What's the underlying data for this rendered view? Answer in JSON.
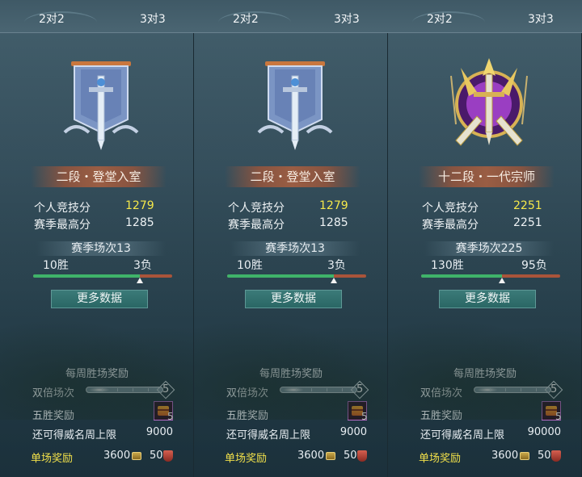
{
  "panels": [
    {
      "tabs": [
        "2对2",
        "3对3"
      ],
      "rank": "二段・登堂入室",
      "score_label": "个人竞技分",
      "score_value": "1279",
      "high_label": "赛季最高分",
      "high_value": "1285",
      "season_label": "赛季场次13",
      "wins": "10胜",
      "losses": "3负",
      "win_ratio": 0.77,
      "more_label": "更多数据",
      "weekly_label": "每周胜场奖励",
      "double_label": "双倍场次",
      "double_count": "5",
      "five_win_label": "五胜奖励",
      "five_win_count": "5",
      "cap_label": "还可得威名周上限",
      "cap_value": "9000",
      "single_label": "单场奖励",
      "coin_value": "3600",
      "shield_value": "50",
      "emblem": "banner-sword-icon"
    },
    {
      "tabs": [
        "2对2",
        "3对3"
      ],
      "rank": "二段・登堂入室",
      "score_label": "个人竞技分",
      "score_value": "1279",
      "high_label": "赛季最高分",
      "high_value": "1285",
      "season_label": "赛季场次13",
      "wins": "10胜",
      "losses": "3负",
      "win_ratio": 0.77,
      "more_label": "更多数据",
      "weekly_label": "每周胜场奖励",
      "double_label": "双倍场次",
      "double_count": "5",
      "five_win_label": "五胜奖励",
      "five_win_count": "5",
      "cap_label": "还可得威名周上限",
      "cap_value": "9000",
      "single_label": "单场奖励",
      "coin_value": "3600",
      "shield_value": "50",
      "emblem": "banner-sword-icon"
    },
    {
      "tabs": [
        "2对2",
        "3对3"
      ],
      "rank": "十二段・一代宗师",
      "score_label": "个人竞技分",
      "score_value": "2251",
      "high_label": "赛季最高分",
      "high_value": "2251",
      "season_label": "赛季场次225",
      "wins": "130胜",
      "losses": "95负",
      "win_ratio": 0.58,
      "more_label": "更多数据",
      "weekly_label": "每周胜场奖励",
      "double_label": "双倍场次",
      "double_count": "5",
      "five_win_label": "五胜奖励",
      "five_win_count": "5",
      "cap_label": "还可得威名周上限",
      "cap_value": "90000",
      "single_label": "单场奖励",
      "coin_value": "3600",
      "shield_value": "50",
      "emblem": "golden-crest-sword-icon"
    }
  ],
  "colors": {
    "score_highlight": "#f5e84a",
    "win_bar": "#3fb36a",
    "loss_bar": "#a9543a",
    "single_label": "#f1e04a"
  }
}
